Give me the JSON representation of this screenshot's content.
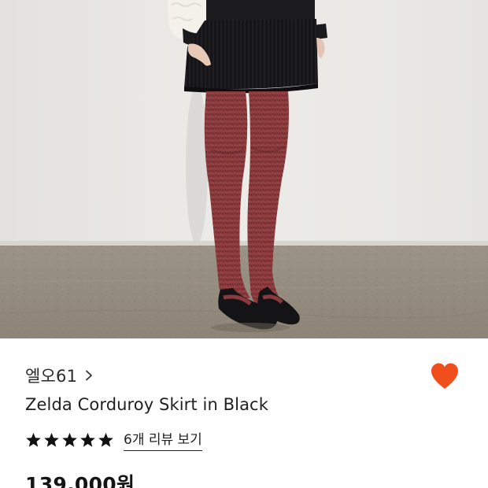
{
  "product": {
    "brand": "엘오61",
    "brand_chevron_icon": "chevron-right-icon",
    "name": "Zelda Corduroy Skirt in Black",
    "rating_stars": 5,
    "star_icon": "star-icon",
    "review_link": "6개 리뷰 보기",
    "price": "139,000원",
    "wishlist_icon": "heart-icon",
    "wishlist_color": "#f04e1c"
  },
  "photo": {
    "description_icon": "product-photo"
  }
}
